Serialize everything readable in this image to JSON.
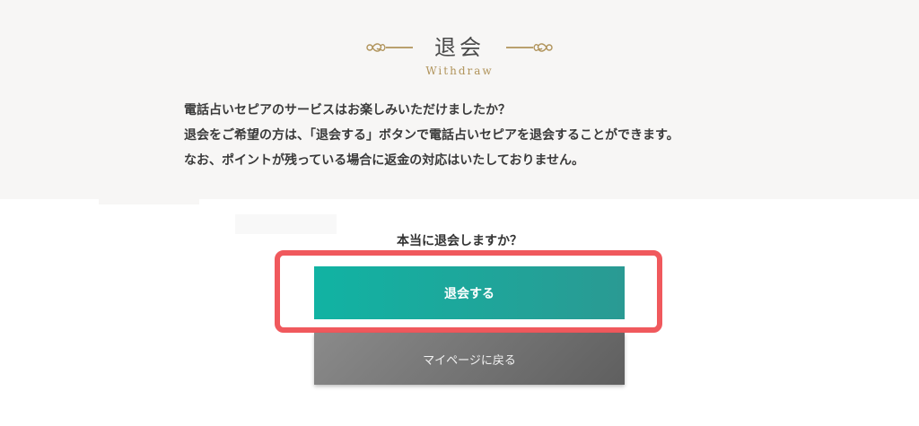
{
  "header": {
    "title": "退会",
    "subtitle": "Withdraw"
  },
  "description": {
    "lines": [
      "電話占いセピアのサービスはお楽しみいただけましたか？",
      "退会をご希望の方は、「退会する」ボタンで電話占いセピアを退会することができます。",
      "なお、ポイントが残っている場合に返金の対応はいたしておりません。"
    ]
  },
  "confirm": {
    "question": "本当に退会しますか？",
    "withdraw_label": "退会する",
    "mypage_label": "マイページに戻る"
  },
  "colors": {
    "accent_gold": "#b0935a",
    "button_teal": "#11b3a3",
    "button_gray": "#6f6f6f",
    "highlight_red": "#f0595d"
  },
  "icons": [
    "left-ornament-icon",
    "right-ornament-icon"
  ]
}
